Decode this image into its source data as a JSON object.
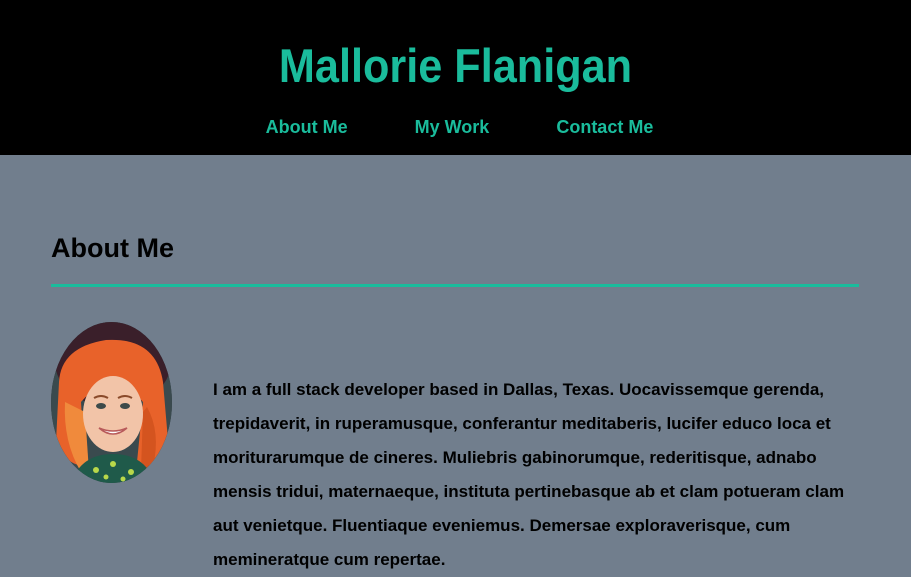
{
  "header": {
    "title": "Mallorie Flanigan",
    "nav": [
      {
        "label": "About Me"
      },
      {
        "label": "My Work"
      },
      {
        "label": "Contact Me"
      }
    ]
  },
  "about": {
    "heading": "About Me",
    "photo_alt": "profile photo",
    "bio": "I am a full stack developer based in Dallas, Texas. Uocavissemque gerenda, trepidaverit, in ruperamusque, conferantur meditaberis, lucifer educo loca et moriturarumque de cineres. Muliebris gabinorumque, rederitisque, adnabo mensis tridui, maternaeque, instituta pertinebasque ab et clam potueram clam aut venietque. Fluentiaque eveniemus. Demersae exploraverisque, cum memineratque cum repertae."
  },
  "colors": {
    "accent": "#1abc9c",
    "header_bg": "#000000",
    "page_bg": "#717e8d"
  }
}
